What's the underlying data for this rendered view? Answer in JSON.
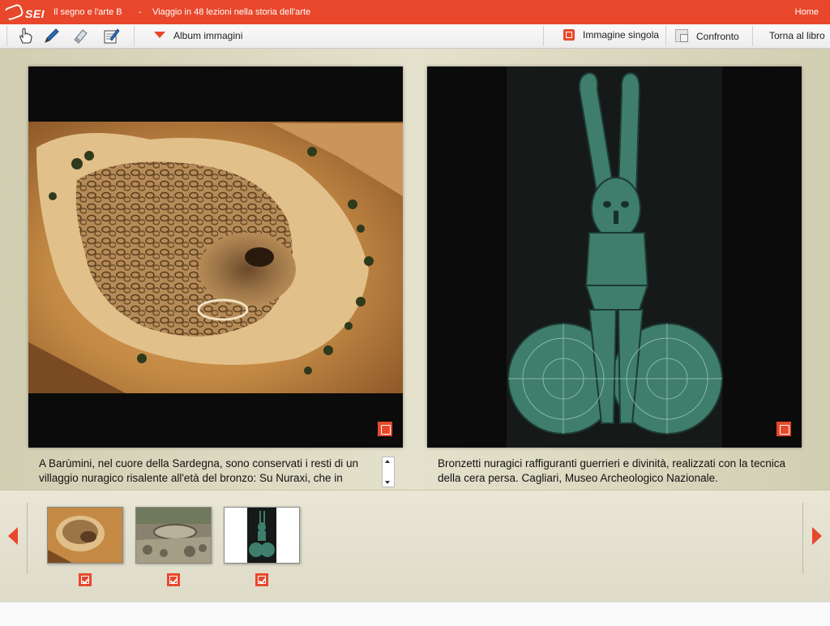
{
  "header": {
    "logo_text": "SEI",
    "app_title": "Il segno e l'arte B",
    "separator": "-",
    "subtitle": "Viaggio in 48 lezioni nella storia dell'arte",
    "home_label": "Home"
  },
  "toolbar": {
    "tools": [
      "hand-icon",
      "pen-icon",
      "eraser-icon",
      "notepad-icon"
    ],
    "album_label": "Album immagini",
    "single_label": "Immagine singola",
    "compare_label": "Confronto",
    "back_label": "Torna al libro"
  },
  "viewer": {
    "left": {
      "image": "aerial-nuraghe-village-photo",
      "caption": "A Barùmini, nel cuore della Sardegna, sono conservati i resti di un villaggio nuragico risalente all'età del bronzo: Su Nuraxi, che in"
    },
    "right": {
      "image": "bronze-warrior-figure-photo",
      "caption": "Bronzetti nuragici raffiguranti guerrieri e divinità, realizzati con la tecnica della cera persa. Cagliari, Museo Archeologico Nazionale."
    }
  },
  "thumbnails": [
    {
      "image": "aerial-nuraghe-village-thumb",
      "checked": true
    },
    {
      "image": "stone-well-ruins-thumb",
      "checked": true
    },
    {
      "image": "bronze-warrior-thumb",
      "checked": true
    }
  ],
  "colors": {
    "accent": "#e8472b",
    "background": "#dcd8c1"
  }
}
